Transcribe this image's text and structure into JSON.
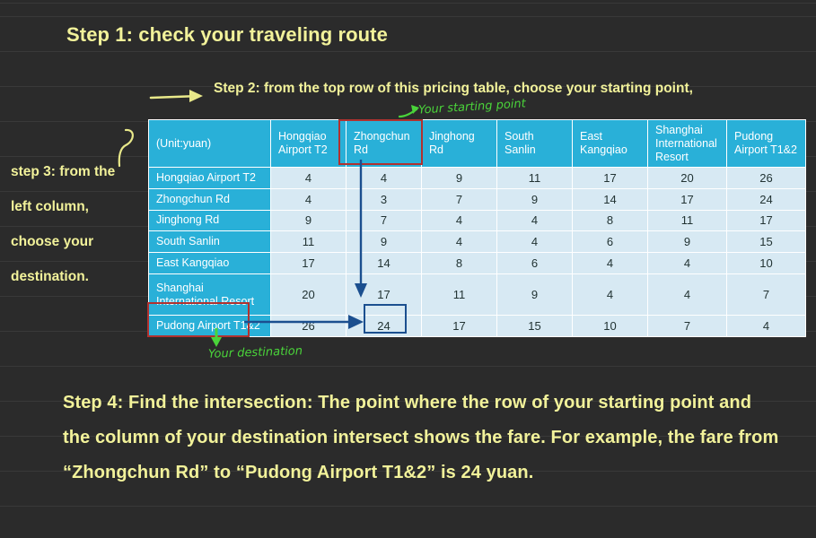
{
  "slide": {
    "background_color": "#2b2b2b",
    "text_color": "#f2f29a",
    "step1": "Step 1:  check your traveling route",
    "step2": "Step 2:  from the top row of this pricing table,   choose your starting point,",
    "step3_lines": [
      "step 3: from the",
      "left column,",
      "choose your",
      "destination."
    ],
    "step4": "Step 4: Find the intersection: The point where the row of your starting point and the column of your destination intersect shows the fare. For example, the fare from “Zhongchun Rd” to “Pudong Airport T1&2” is 24 yuan."
  },
  "annotations": {
    "starting_point_note": "Your starting point",
    "destination_note": "Your destination",
    "note_color": "#4ad43a",
    "highlight_red": "#b1312f",
    "highlight_blue": "#1b4f8f",
    "arrow_yellow": "#e9e98a",
    "highlighted_column": "Zhongchun Rd",
    "highlighted_row": "Pudong Airport T1&2",
    "highlighted_value": "24"
  },
  "chart_data": {
    "type": "table",
    "title": "Pricing table (Unit:yuan)",
    "corner_label": "(Unit:yuan)",
    "header_color": "#29b0d8",
    "cell_color": "#d7e9f3",
    "columns": [
      "Hongqiao Airport T2",
      "Zhongchun Rd",
      "Jinghong Rd",
      "South Sanlin",
      "East Kangqiao",
      "Shanghai International Resort",
      "Pudong Airport T1&2"
    ],
    "rows": [
      "Hongqiao Airport T2",
      "Zhongchun Rd",
      "Jinghong Rd",
      "South Sanlin",
      "East Kangqiao",
      "Shanghai International Resort",
      "Pudong Airport T1&2"
    ],
    "values": [
      [
        4,
        4,
        9,
        11,
        17,
        20,
        26
      ],
      [
        4,
        3,
        7,
        9,
        14,
        17,
        24
      ],
      [
        9,
        7,
        4,
        4,
        8,
        11,
        17
      ],
      [
        11,
        9,
        4,
        4,
        6,
        9,
        15
      ],
      [
        17,
        14,
        8,
        6,
        4,
        4,
        10
      ],
      [
        20,
        17,
        11,
        9,
        4,
        4,
        7
      ],
      [
        26,
        24,
        17,
        15,
        10,
        7,
        4
      ]
    ]
  }
}
